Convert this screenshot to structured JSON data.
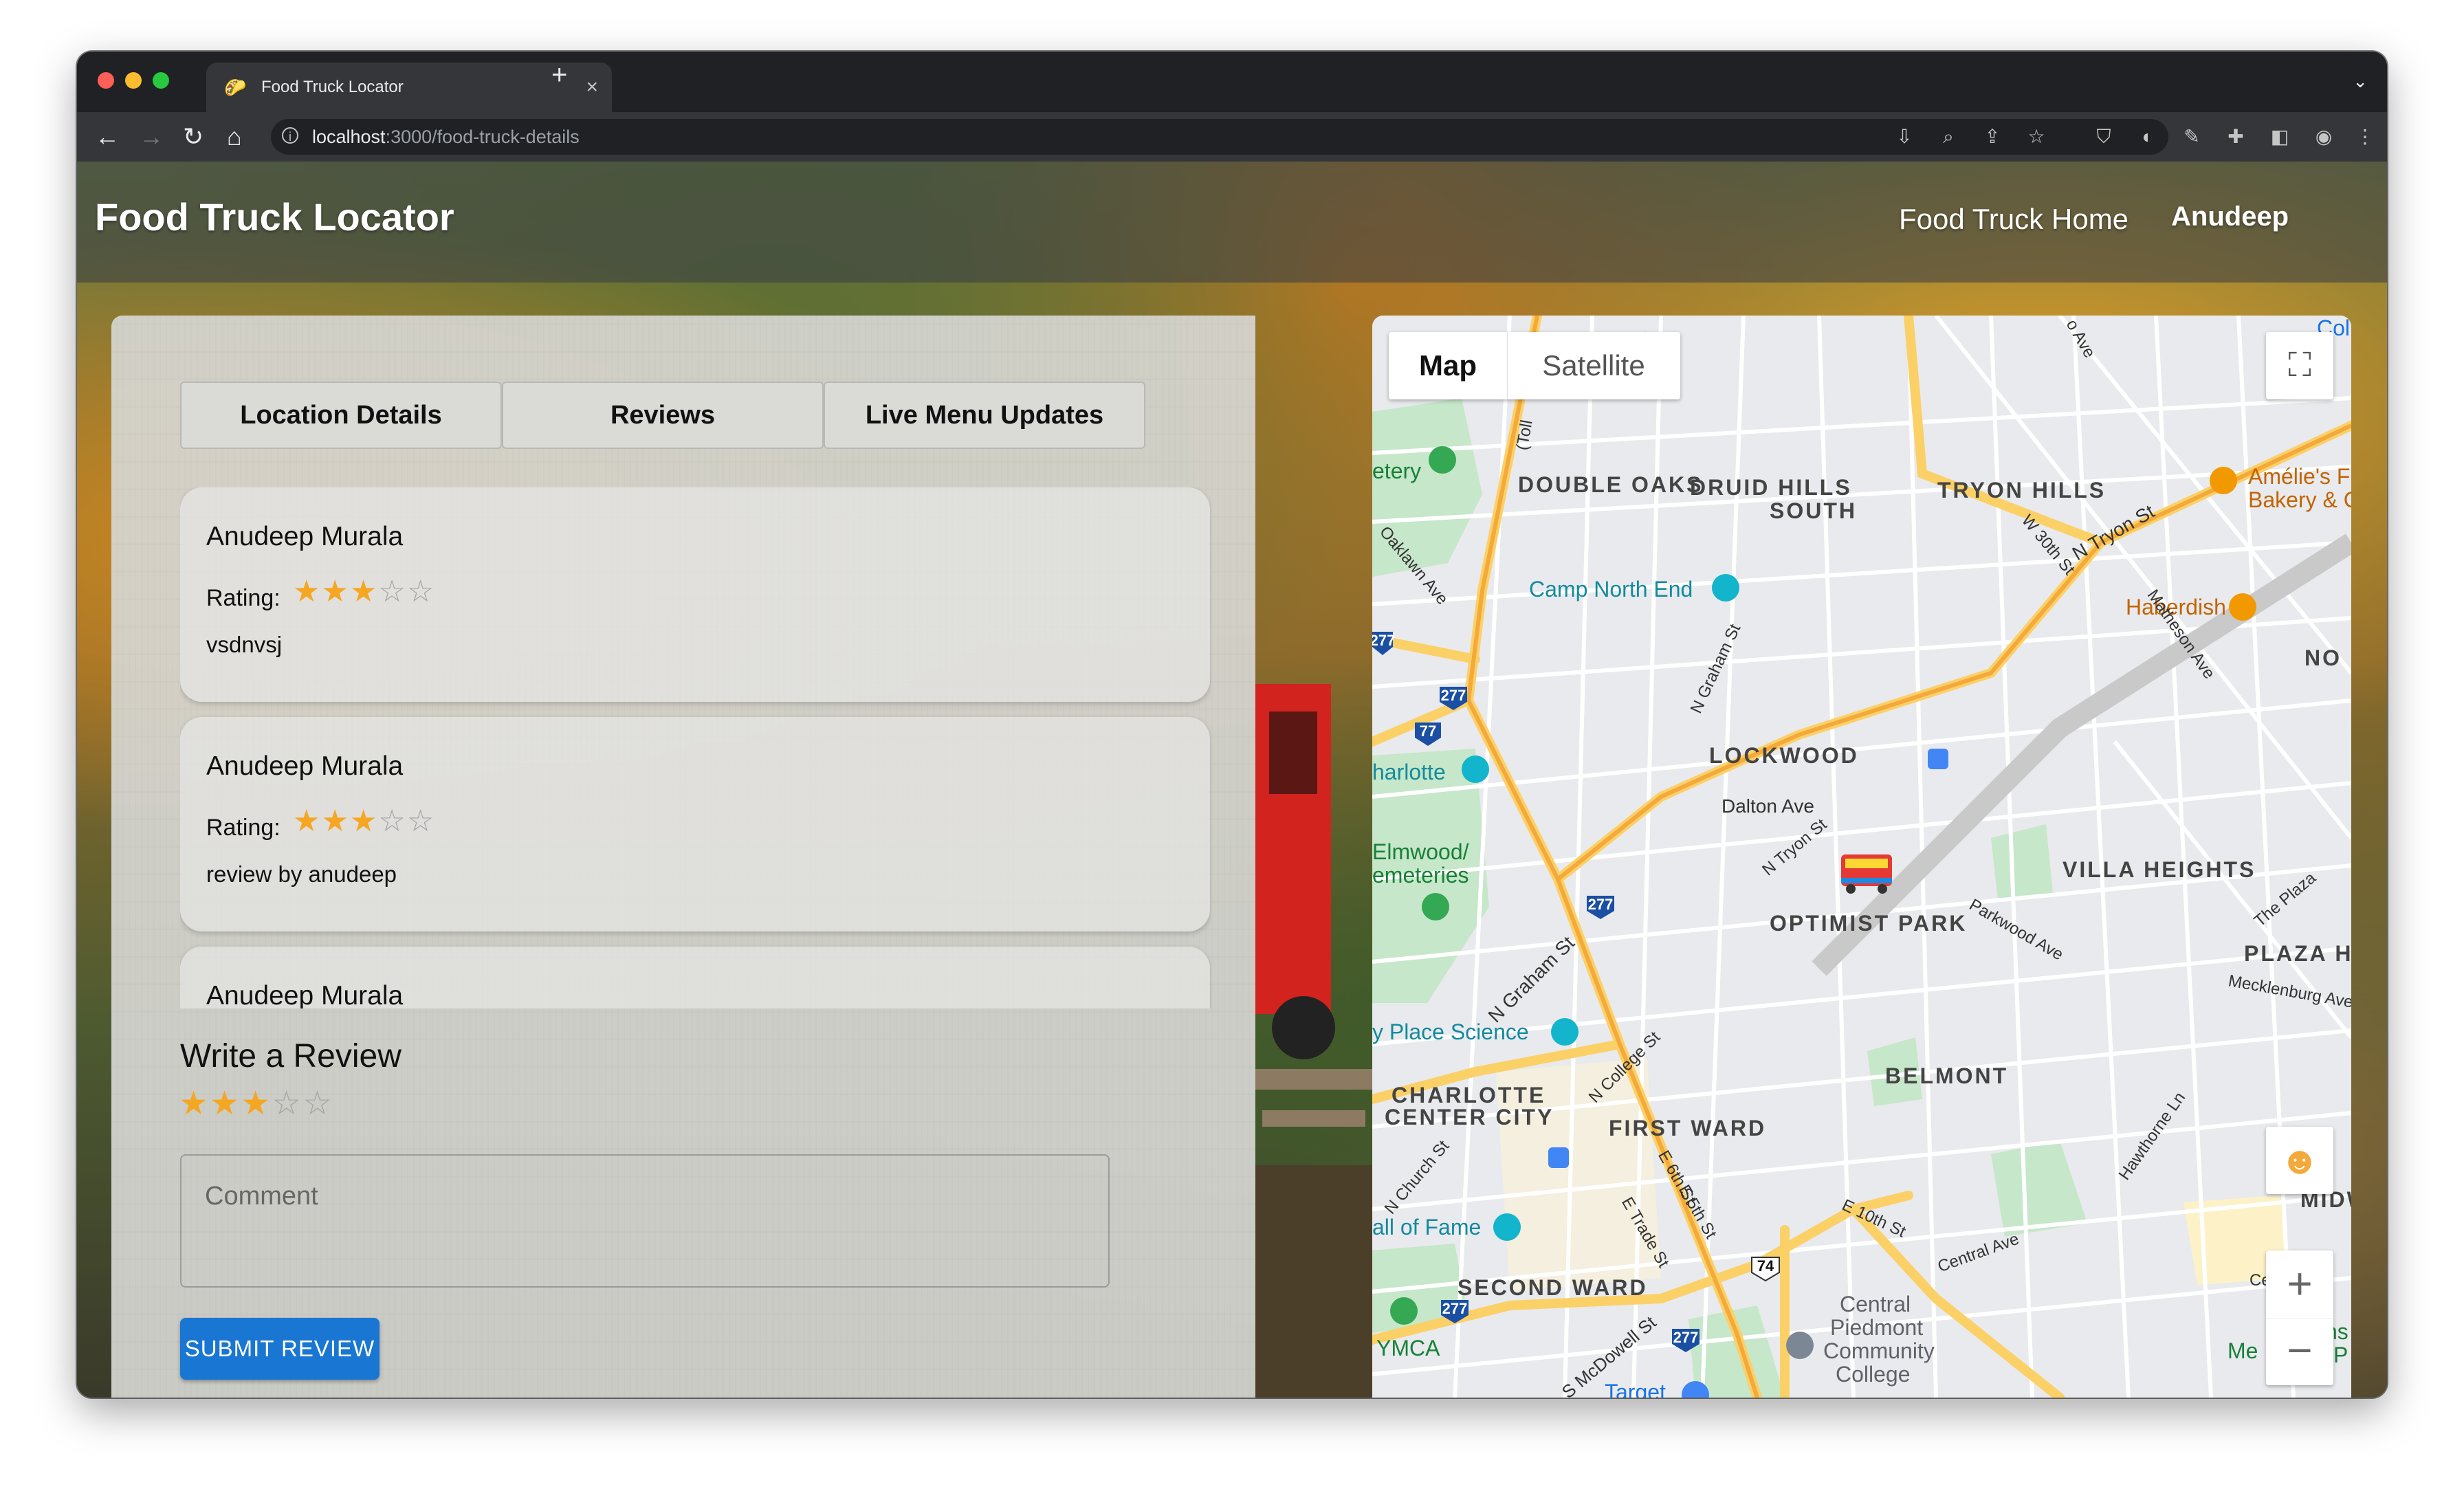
{
  "browser": {
    "tab_title": "Food Truck Locator",
    "tab_icon": "taco-icon",
    "url_host": "localhost",
    "url_path": ":3000/food-truck-details"
  },
  "header": {
    "app_title": "Food Truck Locator",
    "nav": [
      "Food Truck",
      "Home"
    ],
    "user": "Anudeep"
  },
  "details_tabs": [
    "Location Details",
    "Reviews",
    "Live Menu Updates"
  ],
  "reviews": [
    {
      "author": "Anudeep Murala",
      "rating_label": "Rating:",
      "rating": 3,
      "max": 5,
      "comment": "vsdnvsj"
    },
    {
      "author": "Anudeep Murala",
      "rating_label": "Rating:",
      "rating": 3,
      "max": 5,
      "comment": "review by anudeep"
    },
    {
      "author": "Anudeep Murala",
      "rating_label": "",
      "rating": 0,
      "max": 5,
      "comment": ""
    }
  ],
  "write_review": {
    "title": "Write a Review",
    "rating": 3,
    "max": 5,
    "comment_placeholder": "Comment",
    "submit_label": "SUBMIT REVIEW"
  },
  "map": {
    "type_buttons": [
      "Map",
      "Satellite"
    ],
    "selected_type": "Map",
    "labels": {
      "double_oaks": "DOUBLE OAKS",
      "druid_hills": "DRUID HILLS",
      "south": "SOUTH",
      "tryon_hills": "TRYON HILLS",
      "lockwood": "LOCKWOOD",
      "optimist_park": "OPTIMIST PARK",
      "villa_heights": "VILLA HEIGHTS",
      "plaza_h": "PLAZA H",
      "belmont": "BELMONT",
      "charlotte": "CHARLOTTE",
      "center_city": "CENTER CITY",
      "first_ward": "FIRST WARD",
      "second_ward": "SECOND WARD",
      "no": "NO",
      "midw": "MIDW"
    },
    "pois": {
      "camp_north_end": "Camp North End",
      "haberdish": "Haberdish",
      "amelies": "Amélie's F",
      "amelies2": "Bakery & C",
      "charlotte": "harlotte",
      "elmwood1": "Elmwood/",
      "elmwood2": "emeteries",
      "place_science": "y Place Science",
      "hall_of_fame": "all of Fame",
      "ymca": "YMCA",
      "cpcc1": "Central",
      "cpcc2": "Piedmont",
      "cpcc3": "Community",
      "cpcc4": "College",
      "cemetery": "etery",
      "target": "Target",
      "col": "Col",
      "me": "Me",
      "ns": "ns",
      "p": "P"
    },
    "streets": {
      "dalton": "Dalton Ave",
      "n_tryon": "N Tryon St",
      "n_tryon2": "N Tryon St",
      "w30th": "W 30th St",
      "matheson": "Matheson Ave",
      "n_graham": "N Graham St",
      "n_graham2": "N Graham St",
      "oaklawn": "Oaklawn Ave",
      "n_college": "N College St",
      "church": "N Church St",
      "e6th": "E 6th St",
      "e5th": "E 5th St",
      "e_trade": "E Trade St",
      "s_mcdowell": "S McDowell St",
      "e10th": "E 10th St",
      "central": "Central Ave",
      "central2": "Centra",
      "hawthorne": "Hawthorne Ln",
      "parkwood": "Parkwood Ave",
      "the_plaza": "The Plaza",
      "mecklenburg": "Mecklenburg Ave",
      "tollway": "(Toll",
      "ave": "o Ave",
      "st": "St"
    },
    "shields": [
      "277",
      "77",
      "277",
      "277",
      "74",
      "277",
      "277"
    ]
  }
}
